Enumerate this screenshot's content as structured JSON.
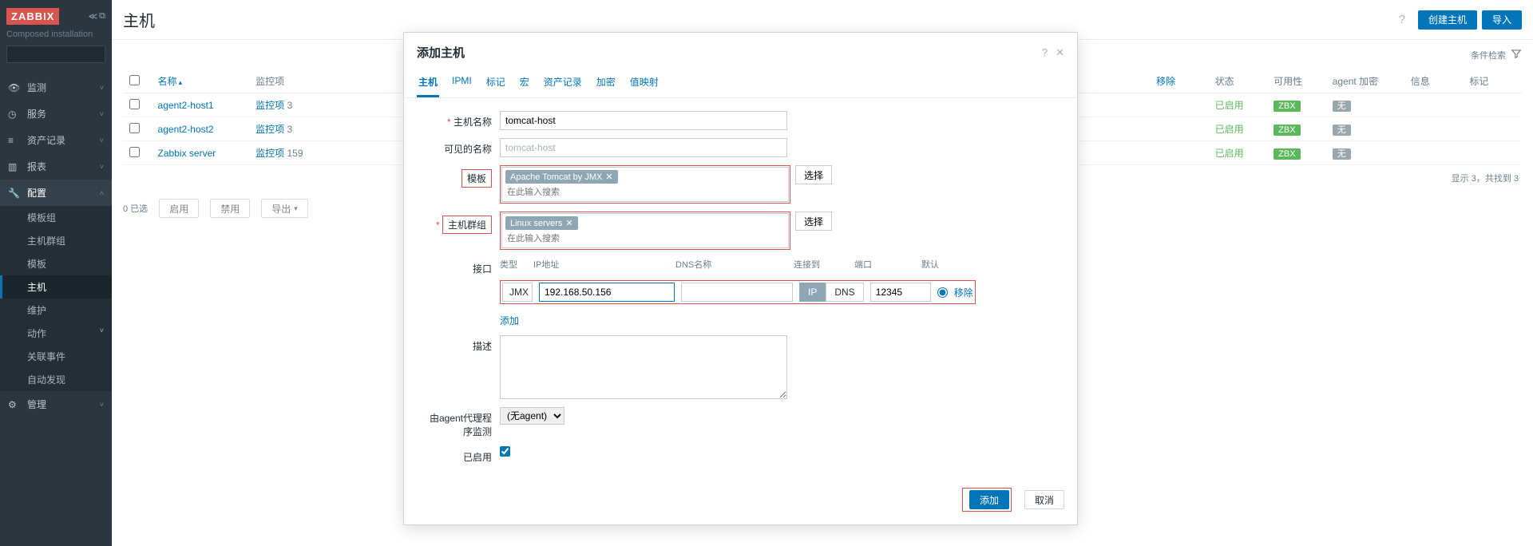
{
  "sidebar": {
    "logo": "ZABBIX",
    "subtitle": "Composed installation",
    "search_placeholder": "",
    "menu": [
      {
        "icon": "eye",
        "label": "监测",
        "open": false
      },
      {
        "icon": "clock",
        "label": "服务",
        "open": false
      },
      {
        "icon": "list",
        "label": "资产记录",
        "open": false
      },
      {
        "icon": "bar",
        "label": "报表",
        "open": false
      },
      {
        "icon": "wrench",
        "label": "配置",
        "open": true,
        "children": [
          {
            "label": "模板组",
            "active": false
          },
          {
            "label": "主机群组",
            "active": false
          },
          {
            "label": "模板",
            "active": false
          },
          {
            "label": "主机",
            "active": true
          },
          {
            "label": "维护",
            "active": false
          },
          {
            "label": "动作",
            "active": false,
            "has_children": true
          },
          {
            "label": "关联事件",
            "active": false
          },
          {
            "label": "自动发现",
            "active": false
          }
        ]
      },
      {
        "icon": "gear",
        "label": "管理",
        "open": false
      }
    ]
  },
  "header": {
    "title": "主机",
    "create_btn": "创建主机",
    "import_btn": "导入"
  },
  "toolbar": {
    "filter_label": "条件检索"
  },
  "table": {
    "headers": {
      "name": "名称",
      "monitors": "监控项",
      "remove": "移除",
      "status": "状态",
      "availability": "可用性",
      "agent_encrypt": "agent 加密",
      "info": "信息",
      "tags": "标记"
    },
    "rows": [
      {
        "name": "agent2-host1",
        "monitors": "监控项",
        "monitors_count": "3",
        "status": "已启用",
        "avail": "ZBX",
        "encrypt": "无"
      },
      {
        "name": "agent2-host2",
        "monitors": "监控项",
        "monitors_count": "3",
        "status": "已启用",
        "avail": "ZBX",
        "encrypt": "无"
      },
      {
        "name": "Zabbix server",
        "monitors": "监控项",
        "monitors_count": "159",
        "status": "已启用",
        "avail": "ZBX",
        "encrypt": "无"
      }
    ],
    "summary": "显示 3，共找到 3"
  },
  "bulk": {
    "selected": "0 已选",
    "enable": "启用",
    "disable": "禁用",
    "export": "导出"
  },
  "modal": {
    "title": "添加主机",
    "tabs": [
      "主机",
      "IPMI",
      "标记",
      "宏",
      "资产记录",
      "加密",
      "值映射"
    ],
    "labels": {
      "hostname": "主机名称",
      "visible_name": "可见的名称",
      "templates": "模板",
      "groups": "主机群组",
      "interfaces": "接口",
      "description": "描述",
      "agent_proxy": "由agent代理程序监测",
      "enabled": "已启用"
    },
    "hostname_value": "tomcat-host",
    "visible_name_placeholder": "tomcat-host",
    "template_tag": "Apache Tomcat by JMX",
    "group_tag": "Linux servers",
    "tag_search_placeholder": "在此输入搜索",
    "select_btn": "选择",
    "iface": {
      "head_type": "类型",
      "head_ip": "IP地址",
      "head_dns": "DNS名称",
      "head_connect": "连接到",
      "head_port": "端口",
      "head_default": "默认",
      "type_value": "JMX",
      "ip_value": "192.168.50.156",
      "dns_value": "",
      "seg_ip": "IP",
      "seg_dns": "DNS",
      "port_value": "12345",
      "remove": "移除",
      "add": "添加"
    },
    "proxy_value": "(无agent)",
    "foot": {
      "add": "添加",
      "cancel": "取消"
    }
  }
}
